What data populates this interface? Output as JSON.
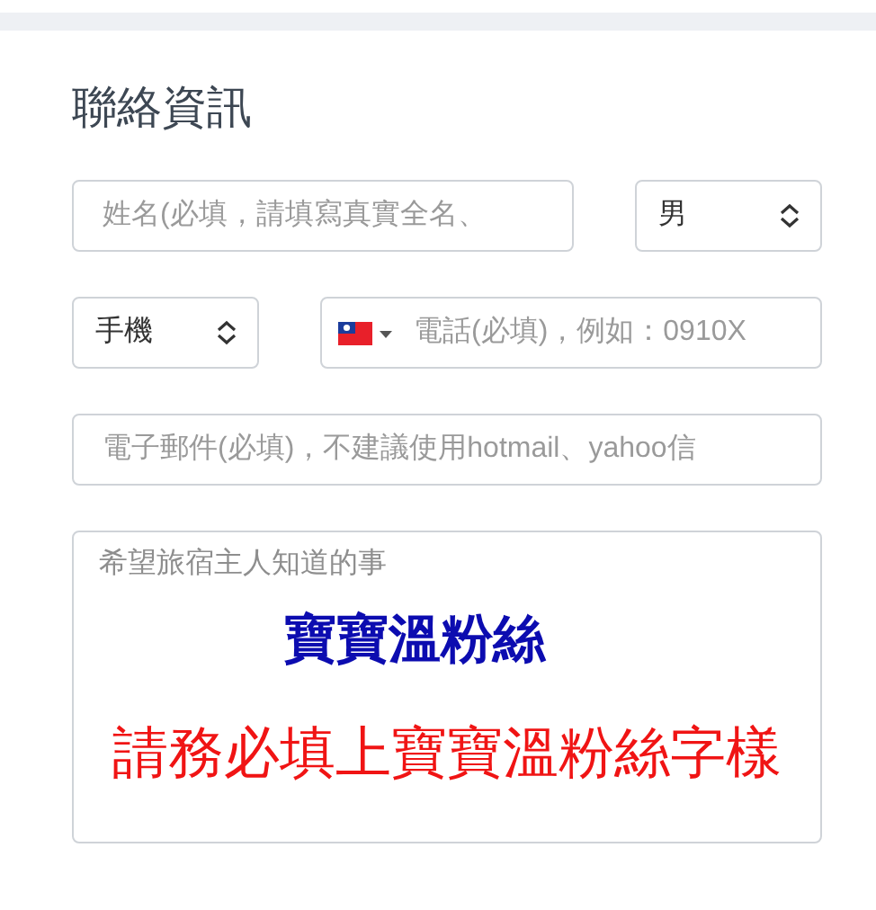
{
  "section_title": "聯絡資訊",
  "name_field": {
    "placeholder": "姓名(必填，請填寫真實全名、"
  },
  "gender_select": {
    "value": "男"
  },
  "phone_type_select": {
    "value": "手機"
  },
  "phone_field": {
    "placeholder": "電話(必填)，例如：0910X"
  },
  "email_field": {
    "placeholder": "電子郵件(必填)，不建議使用hotmail、yahoo信"
  },
  "message_field": {
    "placeholder": "希望旅宿主人知道的事",
    "overlay_notes": [
      {
        "text": "寶寶溫粉絲",
        "color": "#0c0cb0"
      },
      {
        "text": "請務必填上寶寶溫粉絲字樣",
        "color": "#f01414"
      }
    ]
  }
}
